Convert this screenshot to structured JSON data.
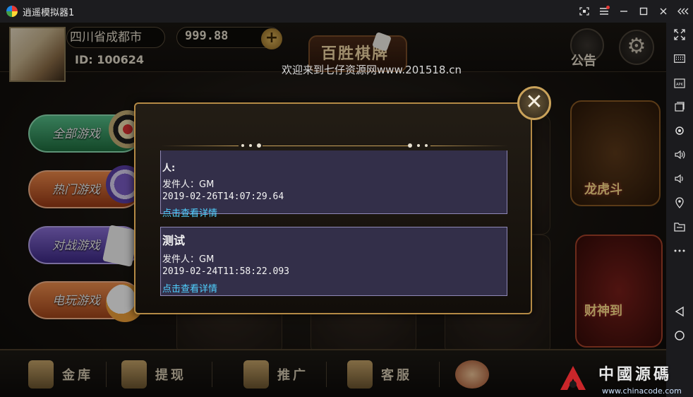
{
  "window": {
    "title": "逍遥模拟器1",
    "controls": [
      "screenshot",
      "menu",
      "minimize",
      "maximize",
      "close",
      "collapse-sidebar"
    ]
  },
  "sidebar": {
    "items": [
      "fullscreen",
      "keyboard-mapping",
      "install-apk",
      "multi-window",
      "settings",
      "volume-up",
      "volume-down",
      "location",
      "files",
      "more",
      "back",
      "home"
    ]
  },
  "header": {
    "location": "四川省成都市",
    "user_id": "ID: 100624",
    "balance": "999.88",
    "add_label": "+",
    "logo_text": "百胜棋牌",
    "notice_label": "公告",
    "settings_label": "⚙"
  },
  "welcome_text": "欢迎来到七仔资源网www.201518.cn",
  "categories": [
    {
      "label": "全部游戏",
      "color": "#2f9a62"
    },
    {
      "label": "热门游戏",
      "color": "#c85a26"
    },
    {
      "label": "对战游戏",
      "color": "#5a43b0"
    },
    {
      "label": "电玩游戏",
      "color": "#cd6428"
    }
  ],
  "promos": {
    "top_label": "龙虎斗",
    "bottom_label": "财神到"
  },
  "bottom_nav": [
    {
      "label": "金库"
    },
    {
      "label": "提现"
    },
    {
      "label": "推广"
    },
    {
      "label": "客服"
    }
  ],
  "mail_dialog": {
    "close_label": "✕",
    "items": [
      {
        "title": "人:",
        "sender": "发件人：GM",
        "time": "2019-02-26T14:07:29.64",
        "link": "点击查看详情"
      },
      {
        "title": "测试",
        "sender": "发件人：GM",
        "time": "2019-02-24T11:58:22.093",
        "link": "点击查看详情"
      }
    ]
  },
  "watermark": {
    "text": "中國源碼",
    "url": "www.chinacode.com"
  }
}
